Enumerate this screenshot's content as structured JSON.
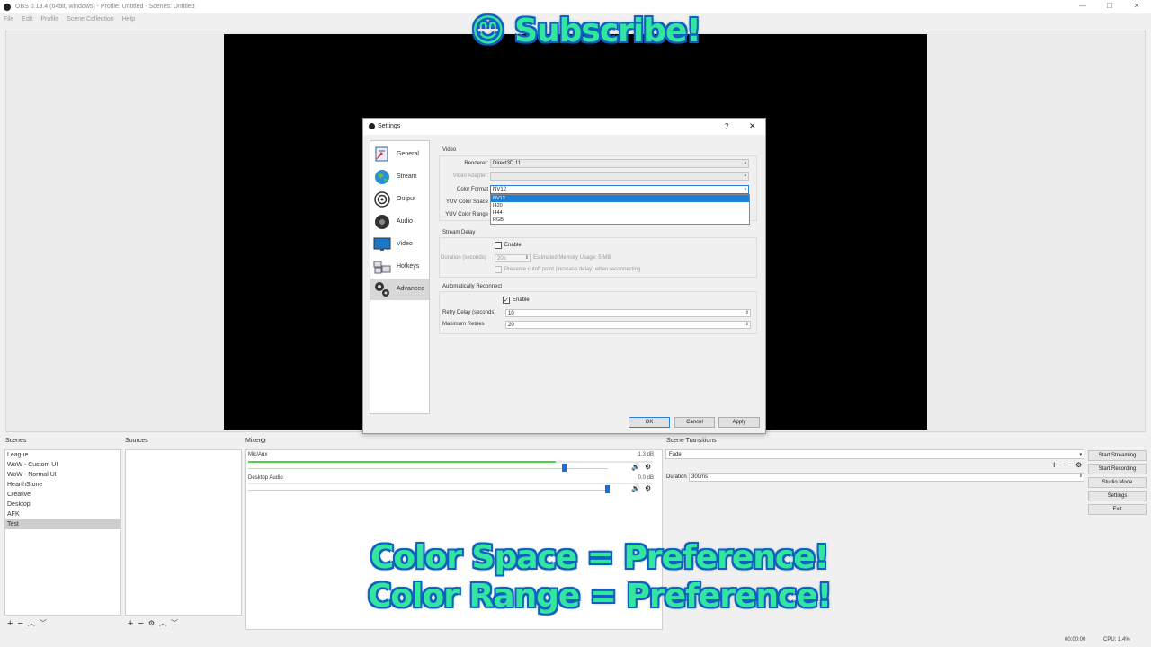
{
  "window": {
    "title": "OBS 0.13.4 (64bit, windows) - Profile: Untitled - Scenes: Untitled",
    "minimize": "—",
    "maximize": "☐",
    "close": "✕"
  },
  "menu": [
    "File",
    "Edit",
    "Profile",
    "Scene Collection",
    "Help"
  ],
  "overlay": {
    "subscribe": "😊 Subscribe!",
    "line1": "Color Space = Preference!",
    "line2": "Color Range = Preference!"
  },
  "docks": {
    "scenes_title": "Scenes",
    "sources_title": "Sources",
    "mixer_title": "Mixer",
    "transitions_title": "Scene Transitions",
    "scenes": [
      "League",
      "WoW - Custom UI",
      "WoW - Normal UI",
      "HearthStone",
      "Creative",
      "Desktop",
      "AFK",
      "Test"
    ],
    "selected_scene_index": 7
  },
  "mixer": {
    "channels": [
      {
        "name": "Mic/Aux",
        "db": "1.3 dB",
        "level": 0.76,
        "volume": 0.88
      },
      {
        "name": "Desktop Audio",
        "db": "0.0 dB",
        "level": 0.0,
        "volume": 1.0
      }
    ]
  },
  "transitions": {
    "selected": "Fade",
    "duration_label": "Duration",
    "duration_value": "300ms"
  },
  "controls": {
    "start_streaming": "Start Streaming",
    "start_recording": "Start Recording",
    "studio_mode": "Studio Mode",
    "settings": "Settings",
    "exit": "Exit"
  },
  "status": {
    "time": "00:00:00",
    "cpu": "CPU: 1.4%"
  },
  "settings": {
    "title": "Settings",
    "help": "?",
    "close": "✕",
    "nav": [
      {
        "label": "General",
        "icon": "general-icon"
      },
      {
        "label": "Stream",
        "icon": "globe-icon"
      },
      {
        "label": "Output",
        "icon": "output-icon"
      },
      {
        "label": "Audio",
        "icon": "speaker-icon"
      },
      {
        "label": "Video",
        "icon": "monitor-icon"
      },
      {
        "label": "Hotkeys",
        "icon": "keyboard-icon"
      },
      {
        "label": "Advanced",
        "icon": "gears-icon"
      }
    ],
    "active_nav": "Advanced",
    "video": {
      "section": "Video",
      "renderer_label": "Renderer:",
      "renderer_value": "Direct3D 11",
      "adapter_label": "Video Adapter:",
      "adapter_value": "",
      "color_format_label": "Color Format",
      "color_format_value": "NV12",
      "color_format_options": [
        "NV12",
        "I420",
        "I444",
        "RGB"
      ],
      "color_space_label": "YUV Color Space",
      "color_range_label": "YUV Color Range"
    },
    "stream_delay": {
      "section": "Stream Delay",
      "enable_label": "Enable",
      "duration_label": "Duration (seconds)",
      "duration_value": "20s",
      "memory_label": "Estimated Memory Usage: 5 MB",
      "preserve_label": "Preserve cutoff point (increase delay) when reconnecting"
    },
    "reconnect": {
      "section": "Automatically Reconnect",
      "enable_label": "Enable",
      "retry_label": "Retry Delay (seconds)",
      "retry_value": "10",
      "max_label": "Maximum Retries",
      "max_value": "20"
    },
    "buttons": {
      "ok": "OK",
      "cancel": "Cancel",
      "apply": "Apply"
    }
  }
}
